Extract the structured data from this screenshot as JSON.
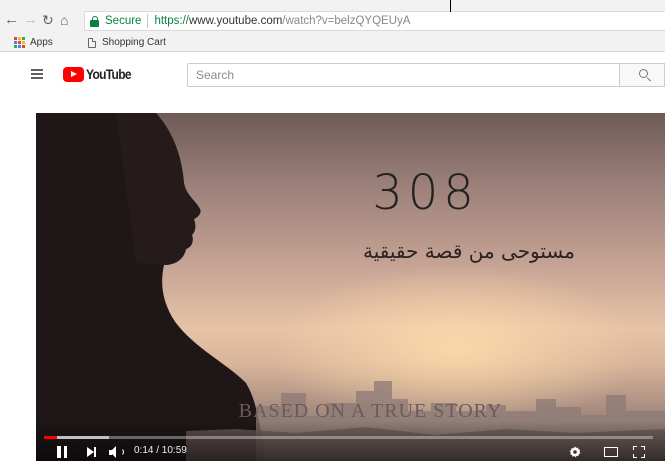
{
  "browser": {
    "secure_label": "Secure",
    "url_scheme": "https://",
    "url_host": "www.youtube.com",
    "url_path": "/watch?v=belzQYQEUyA",
    "bookmarks": [
      {
        "label": "Apps",
        "icon": "apps-grid-icon"
      },
      {
        "label": "Shopping Cart",
        "icon": "page-icon"
      }
    ],
    "colors": {
      "secure": "#0b8043"
    }
  },
  "youtube": {
    "logo_text": "YouTube",
    "search_placeholder": "Search",
    "brand_color": "#ff0000"
  },
  "video": {
    "title_number": "308",
    "arabic_subtitle": "مستوحى من قصة حقيقية",
    "caption": "BASED ON A TRUE STORY",
    "time_current": "0:14",
    "time_total": "10:59",
    "time_display": "0:14 / 10:59",
    "progress_played": 0.021,
    "progress_buffered": 0.106,
    "playing": true
  }
}
